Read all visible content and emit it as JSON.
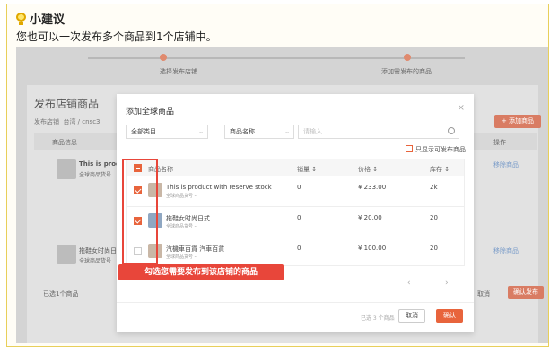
{
  "tip": {
    "title": "小建议",
    "text": "您也可以一次发布多个商品到1个店铺中。"
  },
  "steps": [
    {
      "label": "选择发布店铺"
    },
    {
      "label": "添加需发布的商品"
    }
  ],
  "background": {
    "title": "发布店铺商品",
    "store_label": "发布店铺",
    "store_value": "台湾 / cnsc3",
    "col_product": "商品信息",
    "col_action": "操作",
    "add_button": "+ 添加商品",
    "row1_name": "This is produ",
    "row1_sku": "全球商品货号",
    "row1_action": "移除商品",
    "row2_name": "拖鞋女时尚日",
    "row2_sku": "全球商品货号",
    "row2_action": "移除商品",
    "selected_count": "已选1个商品",
    "cancel": "取消",
    "confirm_publish": "确认发布"
  },
  "modal": {
    "title": "添加全球商品",
    "close": "×",
    "category_select": "全部类目",
    "field_select": "商品名称",
    "search_placeholder": "请输入",
    "only_publishable": "只显示可发布商品",
    "columns": {
      "name": "商品名称",
      "sales": "销量 ↕",
      "price": "价格 ↕",
      "stock": "库存 ↕"
    },
    "rows": [
      {
        "name": "This is product with reserve stock",
        "sku": "全球商品货号 --",
        "sales": "0",
        "price": "¥ 233.00",
        "stock": "2k",
        "checked": true
      },
      {
        "name": "拖鞋女时尚日式",
        "sku": "全球商品货号 --",
        "sales": "0",
        "price": "¥ 20.00",
        "stock": "20",
        "checked": true
      },
      {
        "name": "汽機車百貨 汽車百貨",
        "sku": "全球商品货号 --",
        "sales": "0",
        "price": "¥ 100.00",
        "stock": "20",
        "checked": false
      }
    ],
    "callout": "勾选您需要发布到该店铺的商品",
    "pager_prev": "‹",
    "pager_next": "›",
    "selected_count": "已选 3 个商品",
    "cancel": "取消",
    "ok": "确认"
  },
  "colors": {
    "accent": "#e8643c",
    "highlight": "#e8463a",
    "tip_border": "#e8cf5a"
  }
}
